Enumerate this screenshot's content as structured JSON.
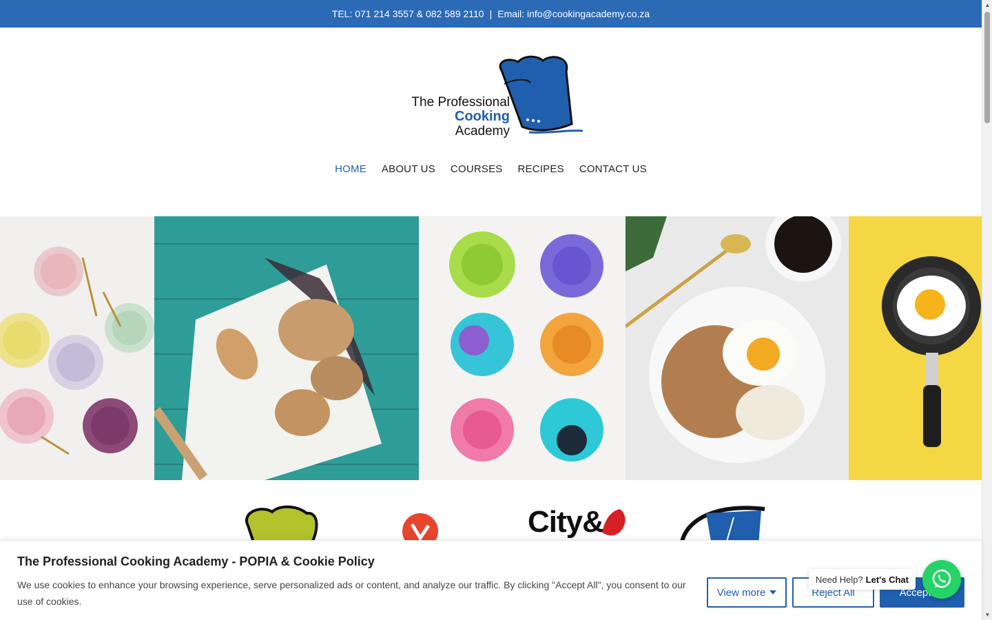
{
  "topbar": {
    "phone": "TEL: 071 214 3557 & 082 589 2110",
    "separator": "|",
    "email": "Email: info@cookingacademy.co.za"
  },
  "logo": {
    "line1": "The Professional",
    "line2": "Cooking",
    "line3": "Academy",
    "icon": "chef-hat-icon"
  },
  "nav": {
    "items": [
      {
        "label": "HOME",
        "active": true
      },
      {
        "label": "ABOUT US",
        "active": false
      },
      {
        "label": "COURSES",
        "active": false
      },
      {
        "label": "RECIPES",
        "active": false
      },
      {
        "label": "CONTACT US",
        "active": false
      }
    ]
  },
  "partners": {
    "city_guilds_text": "City&"
  },
  "cookie": {
    "title": "The Professional Cooking Academy - POPIA & Cookie Policy",
    "text": "We use cookies to enhance your browsing experience, serve personalized ads or content, and analyze our traffic. By clicking \"Accept All\", you consent to our use of cookies.",
    "view_more": "View more",
    "reject": "Reject All",
    "accept": "Accept All"
  },
  "chat": {
    "prefix": "Need Help?",
    "cta": "Let's Chat",
    "icon": "whatsapp-icon"
  },
  "colors": {
    "brand_blue": "#2b6ab5",
    "link_blue": "#1f5fae",
    "whatsapp_green": "#25d366"
  }
}
